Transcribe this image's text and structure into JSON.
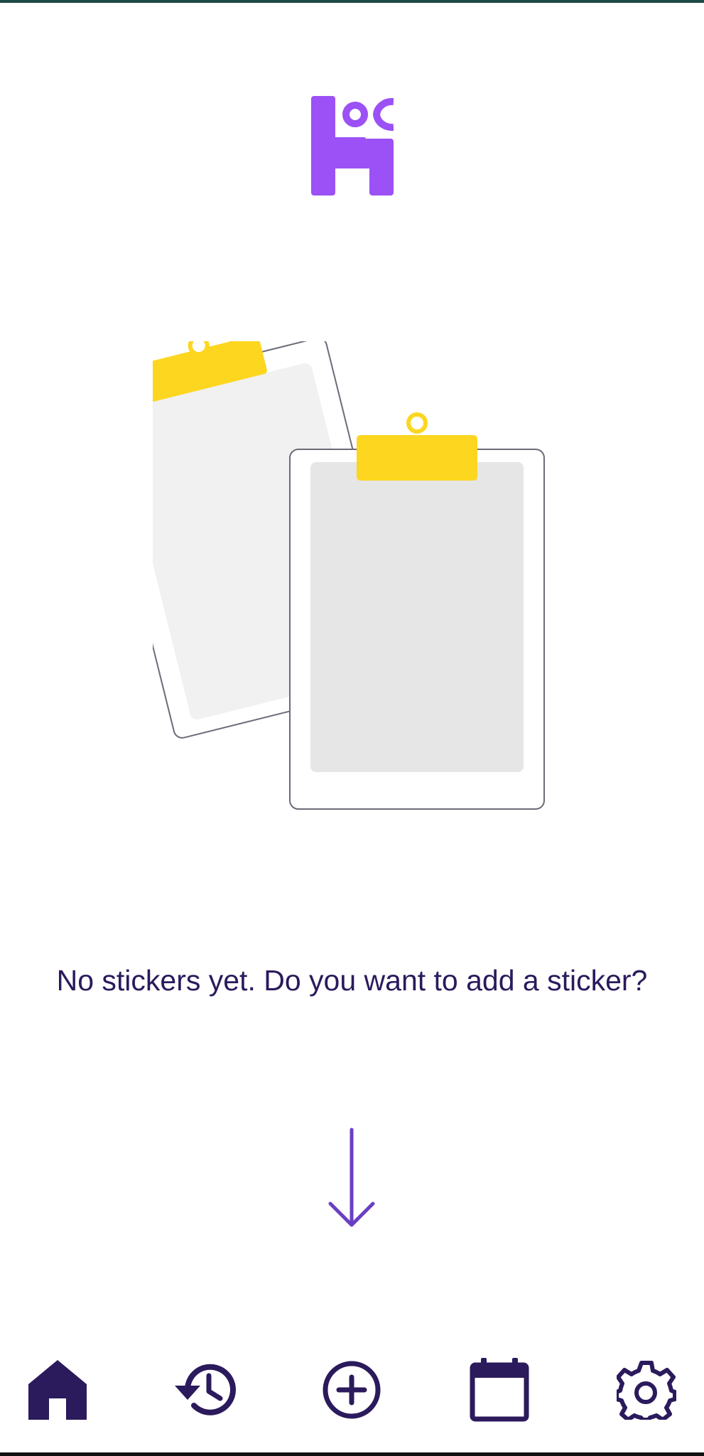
{
  "theme": {
    "primary": "#2b1a5c",
    "accent": "#9b51f5",
    "arrow": "#6b3fc4",
    "clip": "#fdd61f"
  },
  "logo": {
    "icon": "app-logo-icon"
  },
  "empty_state": {
    "illustration": "empty-clipboards-illustration",
    "message": "No stickers yet. Do you want to add a sticker?",
    "arrow_icon": "arrow-down-icon"
  },
  "bottom_nav": {
    "items": [
      {
        "icon": "home-icon",
        "active": true
      },
      {
        "icon": "history-icon",
        "active": false
      },
      {
        "icon": "add-circle-icon",
        "active": false
      },
      {
        "icon": "calendar-icon",
        "active": false
      },
      {
        "icon": "settings-icon",
        "active": false
      }
    ]
  }
}
